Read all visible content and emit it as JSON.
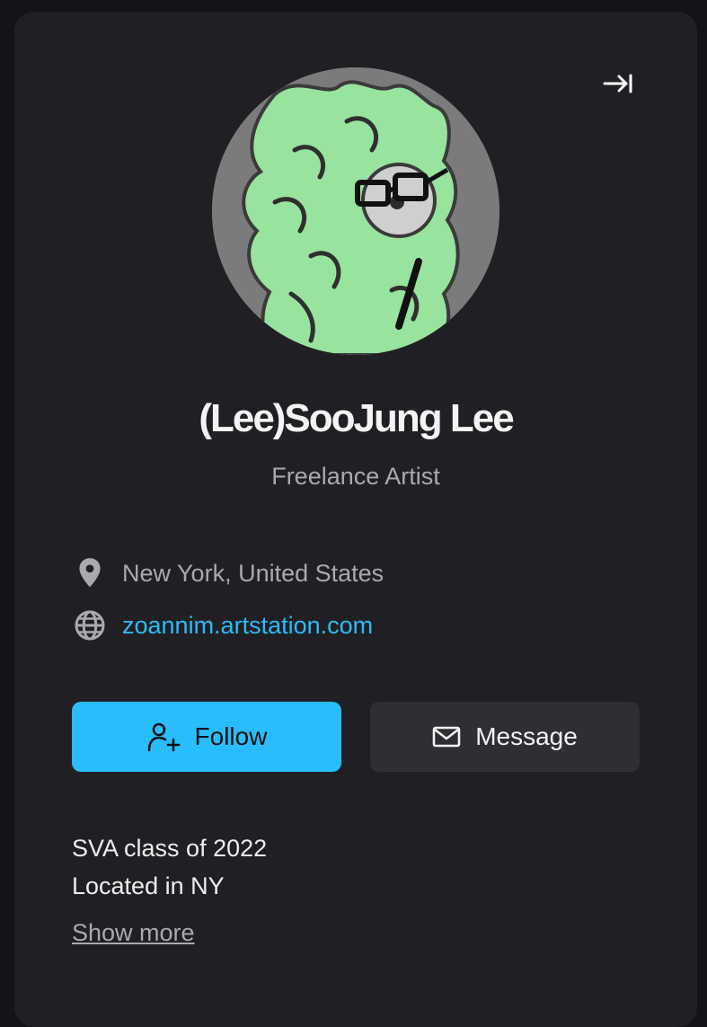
{
  "profile": {
    "name": "(Lee)SooJung Lee",
    "headline": "Freelance Artist",
    "location": "New York, United States",
    "website": "zoannim.artstation.com"
  },
  "actions": {
    "follow_label": "Follow",
    "message_label": "Message"
  },
  "bio": {
    "lines": [
      "SVA class of 2022",
      "Located in NY"
    ],
    "show_more_label": "Show more"
  },
  "icons": {
    "collapse": "collapse-right-icon",
    "location": "location-pin-icon",
    "website": "globe-icon",
    "follow": "add-user-icon",
    "message": "envelope-icon"
  },
  "colors": {
    "accent": "#29bdfd",
    "link": "#2ebaf8",
    "card_bg": "#202024",
    "page_bg": "#141418"
  }
}
